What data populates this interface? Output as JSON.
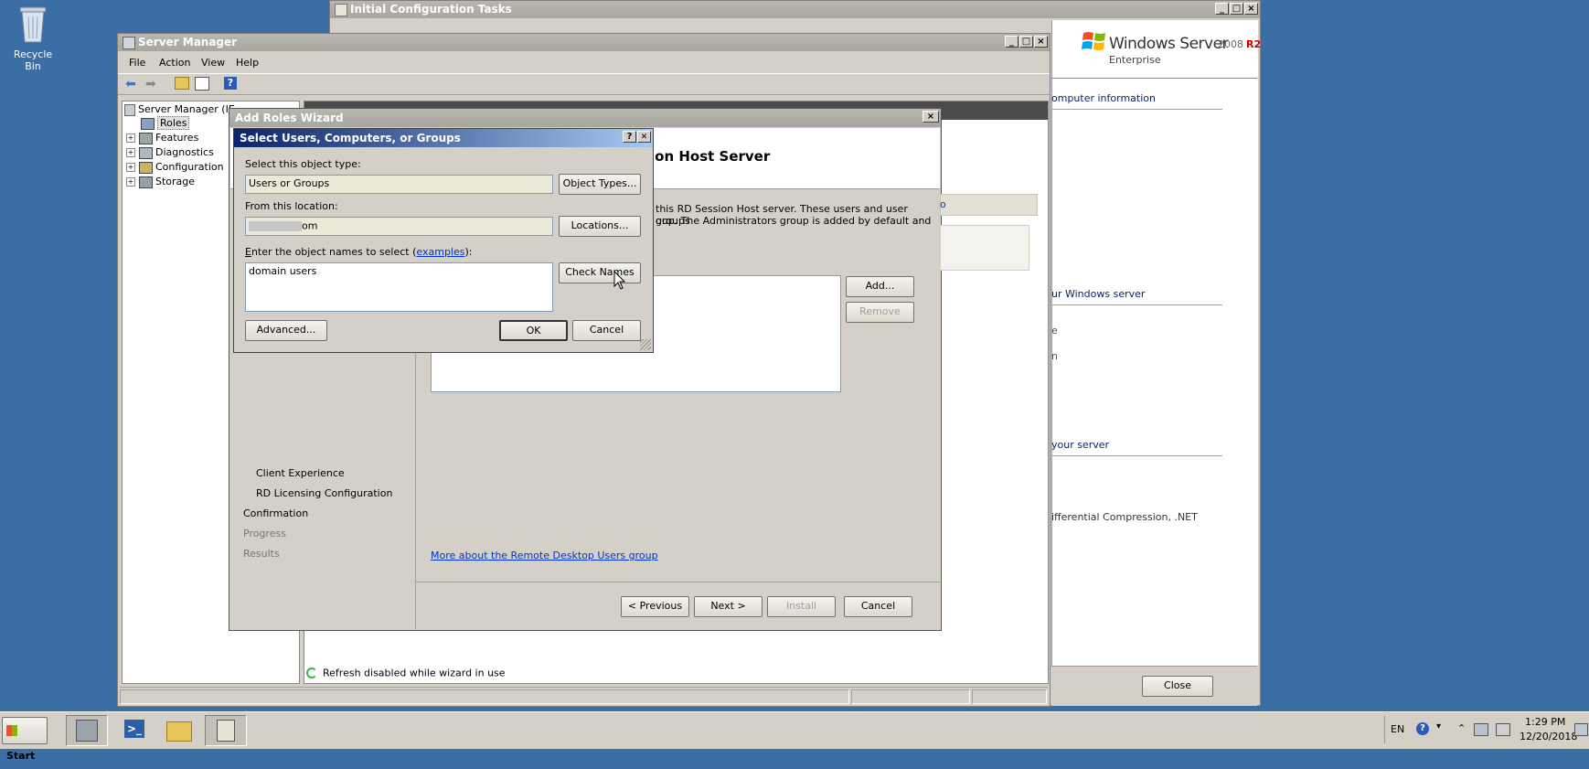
{
  "desktop": {
    "recycle_bin_label": "Recycle Bin"
  },
  "init_tasks": {
    "title": "Initial Configuration Tasks",
    "brand_name": "Windows Server",
    "brand_version": "2008",
    "brand_r2": "R2",
    "brand_edition": "Enterprise",
    "link1": "omputer information",
    "link2": "ur Windows server",
    "text_e": "e",
    "text_n": "n",
    "link3": "your server",
    "text_diff": "ifferential Compression, .NET",
    "close_label": "Close"
  },
  "server_manager": {
    "title": "Server Manager",
    "menu": [
      "File",
      "Action",
      "View",
      "Help"
    ],
    "tree_root": "Server Manager (IE",
    "tree_items": [
      "Roles",
      "Features",
      "Diagnostics",
      "Configuration",
      "Storage"
    ],
    "status_text": "Refresh disabled while wizard in use"
  },
  "wizard": {
    "title": "Add Roles Wizard",
    "heading": "ion Host Server",
    "desc_line1": "this RD Session Host server. These users and user groups",
    "desc_line2": "oup. The Administrators group is added by default and",
    "side_tab_text": "o",
    "nav": [
      "Client Experience",
      "RD Licensing Configuration",
      "Confirmation",
      "Progress",
      "Results"
    ],
    "add_label": "Add...",
    "remove_label": "Remove",
    "more_link": "More about the Remote Desktop Users group",
    "prev_label": "< Previous",
    "next_label": "Next >",
    "install_label": "Install",
    "cancel_label": "Cancel"
  },
  "select_dialog": {
    "title": "Select Users, Computers, or Groups",
    "help_label": "?",
    "close_label": "✕",
    "object_type_label": "Select this object type:",
    "object_type_value": "Users or Groups",
    "object_types_button": "Object Types...",
    "location_label": "From this location:",
    "location_value": "om",
    "locations_button": "Locations...",
    "names_label_prefix": "nter the object names to select (",
    "names_label_accel": "E",
    "names_label_link": "examples",
    "names_label_suffix": "):",
    "names_value": "domain users",
    "check_names_button": "Check Names",
    "advanced_button": "Advanced...",
    "ok_button": "OK",
    "cancel_button": "Cancel"
  },
  "taskbar": {
    "start_label": "Start",
    "lang": "EN",
    "time": "1:29 PM",
    "date": "12/20/2018"
  }
}
